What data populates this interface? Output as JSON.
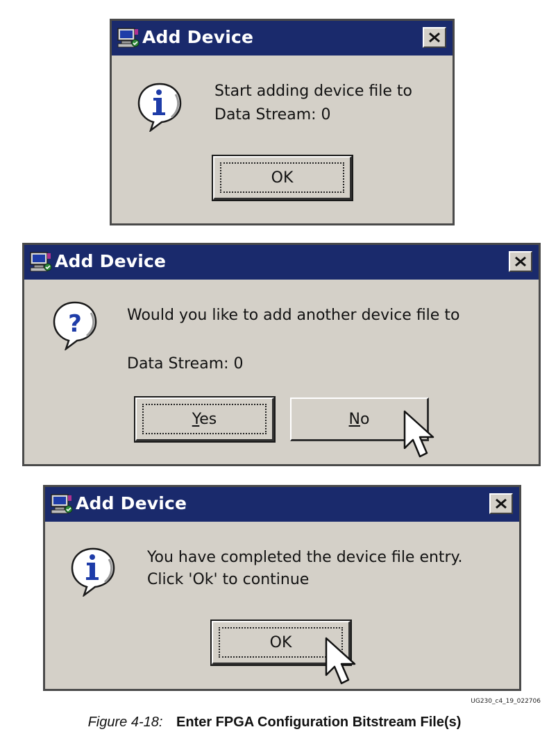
{
  "dialogs": [
    {
      "title": "Add Device",
      "icon": "info-icon",
      "message_lines": [
        "Start adding device file to",
        "Data Stream: 0"
      ],
      "buttons": [
        {
          "label": "OK",
          "default": true
        }
      ]
    },
    {
      "title": "Add Device",
      "icon": "question-icon",
      "message_lines": [
        "Would you like to add another device file to",
        "Data Stream: 0"
      ],
      "buttons": [
        {
          "label": "Yes",
          "mnemonic": "Y",
          "rest": "es",
          "default": true
        },
        {
          "label": "No",
          "mnemonic": "N",
          "rest": "o",
          "default": false
        }
      ]
    },
    {
      "title": "Add Device",
      "icon": "info-icon",
      "message_lines": [
        "You have completed the device file entry.",
        "Click 'Ok' to continue"
      ],
      "buttons": [
        {
          "label": "OK",
          "default": true
        }
      ]
    }
  ],
  "figure": {
    "id": "UG230_c4_19_022706",
    "number": "Figure 4-18:",
    "title": "Enter FPGA Configuration Bitstream File(s)"
  },
  "colors": {
    "titlebar": "#1a2a6c",
    "dialog_face": "#d4d0c8",
    "icon_blue": "#1e3ca8"
  }
}
